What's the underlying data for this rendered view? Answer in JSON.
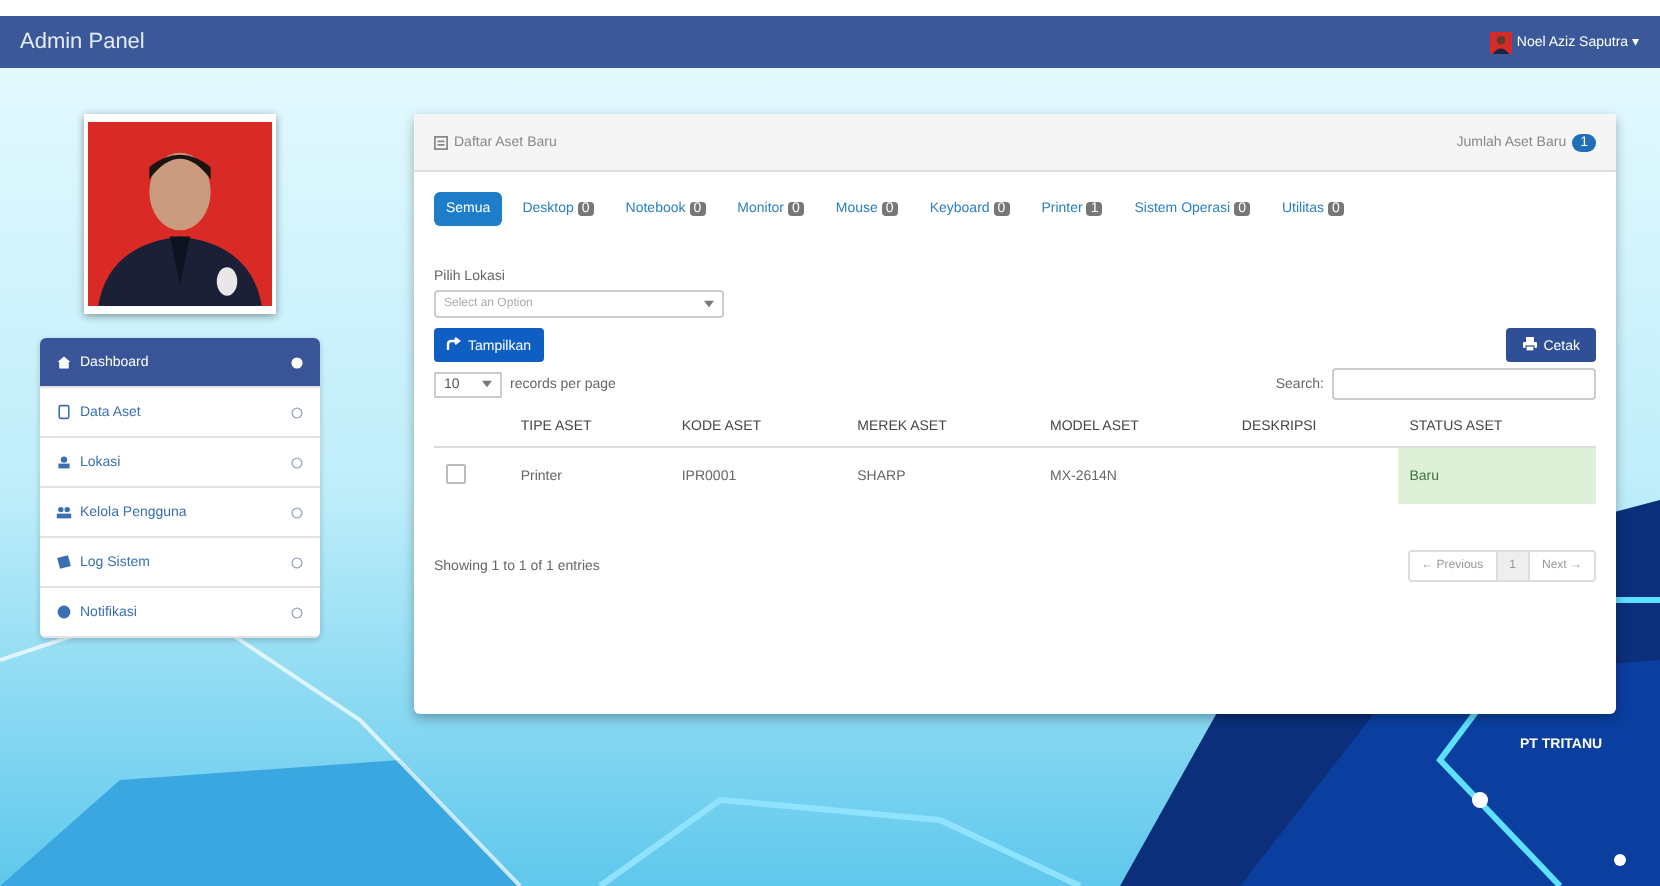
{
  "navbar": {
    "brand": "Admin Panel",
    "user": "Noel Aziz Saputra",
    "caret": "▾"
  },
  "sidebar": {
    "items": [
      {
        "label": "Dashboard",
        "selected": true,
        "kind": "home"
      },
      {
        "label": "Data Aset",
        "selected": false,
        "kind": "tablet"
      },
      {
        "label": "Lokasi",
        "selected": false,
        "kind": "user"
      },
      {
        "label": "Kelola Pengguna",
        "selected": false,
        "kind": "users"
      },
      {
        "label": "Log Sistem",
        "selected": false,
        "kind": "log"
      },
      {
        "label": "Notifikasi",
        "selected": false,
        "kind": "globe"
      }
    ]
  },
  "panel": {
    "title": "Daftar Aset Baru",
    "counter_label": "Jumlah Aset Baru",
    "counter": "1",
    "tabs": [
      {
        "label": "Semua",
        "selected": true
      },
      {
        "label": "Desktop",
        "count": "0",
        "selected": false
      },
      {
        "label": "Notebook",
        "count": "0",
        "selected": false
      },
      {
        "label": "Monitor",
        "count": "0",
        "selected": false
      },
      {
        "label": "Mouse",
        "count": "0",
        "selected": false
      },
      {
        "label": "Keyboard",
        "count": "0",
        "selected": false
      },
      {
        "label": "Printer",
        "count": "1",
        "selected": false
      },
      {
        "label": "Sistem Operasi",
        "count": "0",
        "selected": false
      },
      {
        "label": "Utilitas",
        "count": "0",
        "selected": false
      }
    ],
    "location_label": "Pilih Lokasi",
    "location_placeholder": "Select an Option",
    "show_button": "Tampilkan",
    "print_button": "Cetak",
    "page_size": "10",
    "page_size_label": "records per page",
    "search_label": "Search:",
    "table": {
      "columns": [
        "TIPE ASET",
        "KODE ASET",
        "MEREK ASET",
        "MODEL ASET",
        "DESKRIPSI",
        "STATUS ASET"
      ],
      "rows": [
        {
          "checked": false,
          "cells": [
            "Printer",
            "IPR0001",
            "SHARP",
            "MX-2614N",
            "",
            "Baru"
          ]
        }
      ]
    },
    "info": "Showing 1 to 1 of 1 entries",
    "pagination": {
      "previous": "← Previous",
      "page": "1",
      "next": "Next →"
    }
  },
  "footer_brand": "PT TRITANU"
}
